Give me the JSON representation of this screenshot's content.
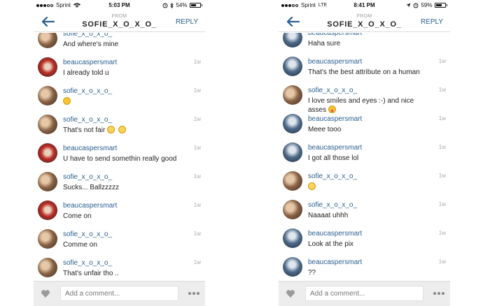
{
  "screens": [
    {
      "status": {
        "carrier": "Sprint",
        "network": "",
        "time": "5:03 PM",
        "battery": "54%",
        "signal_bars": 3,
        "battery_level": 0.54
      },
      "header": {
        "from_label": "FROM",
        "title": "SOFIE_X_O_X_O_",
        "reply_label": "REPLY"
      },
      "messages": [
        {
          "user": "sofie_x_o_x_o_",
          "text": "And where's mine",
          "time": "",
          "avatar": "sofie",
          "emojis": []
        },
        {
          "user": "beaucaspersmart",
          "text": "I already told u",
          "time": "1w",
          "avatar": "beau",
          "emojis": []
        },
        {
          "user": "sofie_x_o_x_o_",
          "text": "",
          "time": "1w",
          "avatar": "sofie",
          "emojis": [
            "sad-face-emoji"
          ]
        },
        {
          "user": "sofie_x_o_x_o_",
          "text": "That's not fair",
          "time": "1w",
          "avatar": "sofie",
          "emojis": [
            "grin-emoji",
            "grin-emoji"
          ]
        },
        {
          "user": "beaucaspersmart",
          "text": "U have to send somethin really good",
          "time": "1w",
          "avatar": "beau",
          "emojis": []
        },
        {
          "user": "sofie_x_o_x_o_",
          "text": "Sucks... Ballzzzzz",
          "time": "1w",
          "avatar": "sofie",
          "emojis": []
        },
        {
          "user": "beaucaspersmart",
          "text": "Come on",
          "time": "1w",
          "avatar": "beau",
          "emojis": []
        },
        {
          "user": "sofie_x_o_x_o_",
          "text": "Comme on",
          "time": "1w",
          "avatar": "sofie",
          "emojis": []
        },
        {
          "user": "sofie_x_o_x_o_",
          "text": "That's unfair tho ..",
          "time": "1w",
          "avatar": "sofie",
          "emojis": []
        }
      ],
      "composer": {
        "placeholder": "Add a comment...",
        "heart_icon": "heart-icon",
        "more_icon": "more-options-icon"
      }
    },
    {
      "status": {
        "carrier": "Sprint",
        "network": "LTE",
        "time": "8:41 PM",
        "battery": "59%",
        "signal_bars": 3,
        "battery_level": 0.59
      },
      "header": {
        "from_label": "FROM",
        "title": "SOFIE_X_O_X_O_",
        "reply_label": "REPLY"
      },
      "messages": [
        {
          "user": "beaucaspersmart",
          "text": "Haha sure",
          "time": "",
          "avatar": "beau",
          "emojis": []
        },
        {
          "user": "beaucaspersmart",
          "text": "That's the best attribute on a human",
          "time": "1w",
          "avatar": "beau",
          "emojis": []
        },
        {
          "user": "sofie_x_o_x_o_",
          "text": "I love smiles and eyes :-) and nice asses",
          "time": "1w",
          "avatar": "sofie",
          "emojis": [
            "tongue-emoji"
          ]
        },
        {
          "user": "beaucaspersmart",
          "text": "Meee tooo",
          "time": "1w",
          "avatar": "beau",
          "emojis": []
        },
        {
          "user": "beaucaspersmart",
          "text": "I got all those lol",
          "time": "1w",
          "avatar": "beau",
          "emojis": []
        },
        {
          "user": "sofie_x_o_x_o_",
          "text": "",
          "time": "1w",
          "avatar": "sofie",
          "emojis": [
            "shy-emoji"
          ]
        },
        {
          "user": "sofie_x_o_x_o_",
          "text": "Naaaat uhhh",
          "time": "1w",
          "avatar": "sofie",
          "emojis": []
        },
        {
          "user": "beaucaspersmart",
          "text": "Look at the pix",
          "time": "1w",
          "avatar": "beau",
          "emojis": []
        },
        {
          "user": "beaucaspersmart",
          "text": "??",
          "time": "1w",
          "avatar": "beau",
          "emojis": []
        }
      ],
      "composer": {
        "placeholder": "Add a comment...",
        "heart_icon": "heart-icon",
        "more_icon": "more-options-icon"
      }
    }
  ],
  "colors": {
    "accent": "#2a5f8f",
    "timestamp": "#aaaaaa",
    "composer_bg": "#ededed"
  }
}
